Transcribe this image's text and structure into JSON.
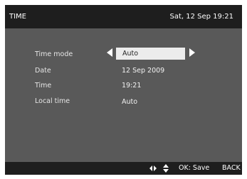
{
  "header": {
    "title": "TIME",
    "datetime": "Sat, 12 Sep 19:21"
  },
  "settings": [
    {
      "label": "Time mode",
      "value": "Auto"
    },
    {
      "label": "Date",
      "value": "12 Sep 2009"
    },
    {
      "label": "Time",
      "value": "19:21"
    },
    {
      "label": "Local time",
      "value": "Auto"
    }
  ],
  "footer": {
    "icons": [
      "left-right-arrows-icon",
      "up-down-arrows-icon"
    ],
    "ok_label": "OK: Save",
    "back_label": "BACK"
  },
  "colors": {
    "background": "#595959",
    "bar": "#1e1e1e",
    "highlight": "#ececec"
  }
}
